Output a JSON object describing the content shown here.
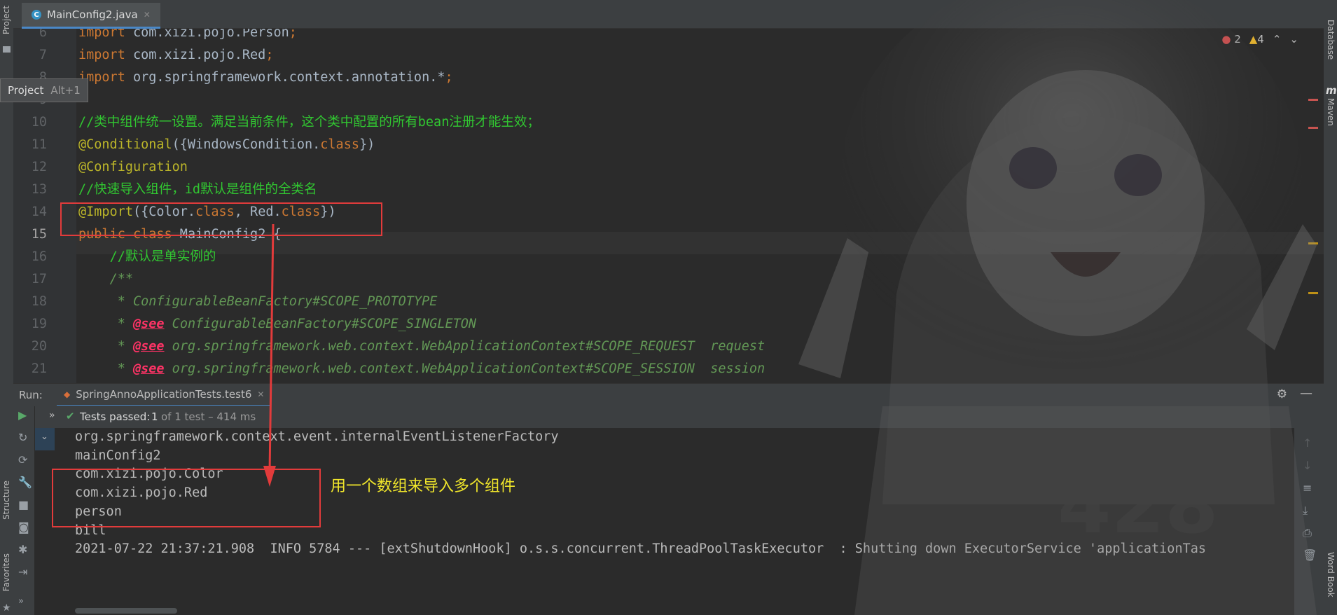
{
  "left_strip": {
    "project_label": "Project",
    "structure_label": "Structure",
    "favorites_label": "Favorites"
  },
  "right_strip": {
    "database_label": "Database",
    "maven_label": "Maven",
    "wordbook_label": "Word Book"
  },
  "tab": {
    "filename": "MainConfig2.java",
    "close": "✕",
    "icon_letter": "C"
  },
  "tooltip": {
    "label": "Project",
    "shortcut": "Alt+1"
  },
  "inspections": {
    "errors": "2",
    "warnings": "4"
  },
  "code_lines": [
    {
      "num": "6",
      "text": "import com.xizi.pojo.Person;"
    },
    {
      "num": "7",
      "text": "import com.xizi.pojo.Red;"
    },
    {
      "num": "8",
      "text": "import org.springframework.context.annotation.*;"
    },
    {
      "num": "9",
      "text": ""
    },
    {
      "num": "10",
      "text": "//类中组件统一设置。满足当前条件，这个类中配置的所有bean注册才能生效；"
    },
    {
      "num": "11",
      "text": "@Conditional({WindowsCondition.class})"
    },
    {
      "num": "12",
      "text": "@Configuration"
    },
    {
      "num": "13",
      "text": "//快速导入组件，id默认是组件的全类名"
    },
    {
      "num": "14",
      "text": "@Import({Color.class, Red.class})"
    },
    {
      "num": "15",
      "text": "public class MainConfig2 {"
    },
    {
      "num": "16",
      "text": "//默认是单实例的"
    },
    {
      "num": "17",
      "text": "/**"
    },
    {
      "num": "18",
      "text": "* ConfigurableBeanFactory#SCOPE_PROTOTYPE"
    },
    {
      "num": "19",
      "text": "* @see ConfigurableBeanFactory#SCOPE_SINGLETON"
    },
    {
      "num": "20",
      "text": "* @see org.springframework.web.context.WebApplicationContext#SCOPE_REQUEST  request"
    },
    {
      "num": "21",
      "text": "* @see org.springframework.web.context.WebApplicationContext#SCOPE_SESSION  session"
    }
  ],
  "run": {
    "label": "Run:",
    "config": "SpringAnnoApplicationTests.test6",
    "close": "✕"
  },
  "tests": {
    "status": "Tests passed:",
    "count": "1",
    "detail": "of 1 test – 414 ms"
  },
  "console_lines": [
    "org.springframework.context.event.internalEventListenerFactory",
    "mainConfig2",
    "com.xizi.pojo.Color",
    "com.xizi.pojo.Red",
    "person",
    "bill",
    "2021-07-22 21:37:21.908  INFO 5784 --- [extShutdownHook] o.s.s.concurrent.ThreadPoolTaskExecutor  : Shutting down ExecutorService 'applicationTas"
  ],
  "callout": "用一个数组来导入多个组件",
  "colors": {
    "accent": "#4a88c7",
    "annotation_red": "#e23b3b",
    "callout_yellow": "#f0e62b"
  }
}
